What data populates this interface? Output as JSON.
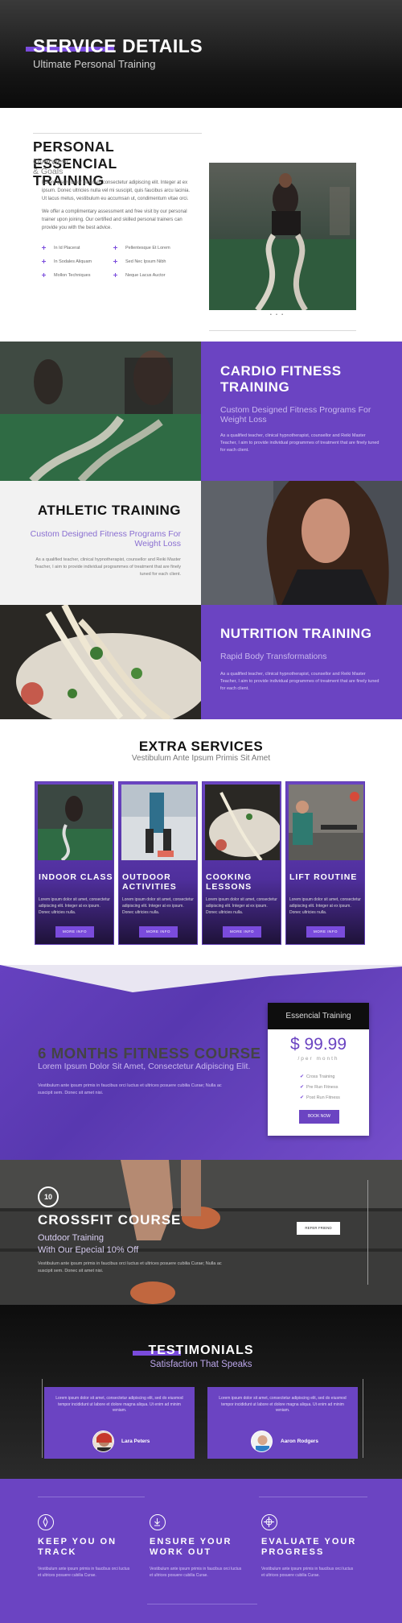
{
  "hero": {
    "title": "SERVICE DETAILS",
    "subtitle": "Ultimate Personal Training"
  },
  "personal": {
    "title": "PERSONAL ESSENCIAL TRAINING",
    "subtitle": "Overview & Goals",
    "p1": "Lorem ipsum dolor sit amet, consectetur adipiscing elit. Integer at ex ipsum. Donec ultricies nulla vel mi suscipit, quis faucibus arcu lacinia. Ut lacus metus, vestibulum eu accumsan ut, condimentum vitae orci.",
    "p2": "We offer a complimentary assessment and free visit by our personal trainer upon joining. Our certified and skilled personal trainers can provide you with the best advice.",
    "features": [
      "In Id Placerat",
      "In Sodales Aliquam",
      "Mollon Techniques",
      "Pellentesque Et Lorem",
      "Sed Nec Ipsum Nibh",
      "Neque Lacus Auctor"
    ],
    "dots": "• • •"
  },
  "cardio": {
    "title": "CARDIO FITNESS TRAINING",
    "subtitle": "Custom Designed Fitness Programs For Weight Loss",
    "text": "As a qualified teacher, clinical hypnotherapist, counsellor and Reiki Master Teacher, I aim to provide individual programmes of treatment that are finely tuned for each client."
  },
  "athletic": {
    "title": "ATHLETIC TRAINING",
    "subtitle": "Custom Designed Fitness Programs For Weight Loss",
    "text": "As a qualified teacher, clinical hypnotherapist, counsellor and Reiki Master Teacher, I aim to provide individual programmes of treatment that are finely tuned for each client."
  },
  "nutrition": {
    "title": "NUTRITION TRAINING",
    "subtitle": "Rapid Body Transformations",
    "text": "As a qualified teacher, clinical hypnotherapist, counsellor and Reiki Master Teacher, I aim to provide individual programmes of treatment that are finely tuned for each client."
  },
  "extra": {
    "title": "EXTRA SERVICES",
    "subtitle": "Vestibulum Ante Ipsum Primis Sit Amet",
    "cards": [
      {
        "title": "INDOOR CLASS",
        "text": "Lorem ipsum dolor sit amet, consectetur adipiscing elit. Integer at ex ipsum. Donec ultricies nulla.",
        "button": "MORE INFO"
      },
      {
        "title": "OUTDOOR ACTIVITIES",
        "text": "Lorem ipsum dolor sit amet, consectetur adipiscing elit. Integer at ex ipsum. Donec ultricies nulla.",
        "button": "MORE INFO"
      },
      {
        "title": "COOKING LESSONS",
        "text": "Lorem ipsum dolor sit amet, consectetur adipiscing elit. Integer at ex ipsum. Donec ultricies nulla.",
        "button": "MORE INFO"
      },
      {
        "title": "LIFT ROUTINE",
        "text": "Lorem ipsum dolor sit amet, consectetur adipiscing elit. Integer at ex ipsum. Donec ultricies nulla.",
        "button": "MORE INFO"
      }
    ]
  },
  "course": {
    "title": "6 MONTHS FITNESS COURSE",
    "subtitle": "Lorem Ipsum Dolor Sit Amet, Consectetur Adipiscing Elit.",
    "text": "Vestibulum ante ipsum primis in faucibus orci luctus et ultrices posuere cubilia Curae; Nulla ac suscipit sem. Donec sit amet nisi.",
    "price": {
      "header": "Essencial Training",
      "amount": "$ 99.99",
      "period": "/per month",
      "items": [
        "Cross Training",
        "Pre Run Fitness",
        "Post Run Fitness"
      ],
      "button": "BOOK NOW"
    }
  },
  "crossfit": {
    "badge": "10",
    "title": "CROSSFIT COURSE",
    "subtitle1": "Outdoor Training",
    "subtitle2": "With Our Epecial 10% Off",
    "text": "Vestibulum ante ipsum primis in faucibus orci luctus et ultrices posuere cubilia Curae; Nulla ac suscipit sem. Donec sit amet nisi.",
    "button": "REFER FRIEND"
  },
  "testimonials": {
    "title": "TESTIMONIALS",
    "subtitle": "Satisfaction That Speaks",
    "items": [
      {
        "text": "Lorem ipsum dolor sit amet, consectetur adipiscing elit, sed do eiusmod tempor incididunt ut labore et dolore magna aliqua. Ut enim ad minim veniam.",
        "name": "Lara Peters"
      },
      {
        "text": "Lorem ipsum dolor sit amet, consectetur adipiscing elit, sed do eiusmod tempor incididunt ut labore et dolore magna aliqua. Ut enim ad minim veniam.",
        "name": "Aaron Rodgers"
      }
    ]
  },
  "goals": [
    {
      "icon": "compass-icon",
      "title": "KEEP YOU ON TRACK",
      "text": "Vestibulum ante ipsum primis in faucibus orci luctus et ultrices posuere cubilia Curae."
    },
    {
      "icon": "download-icon",
      "title": "ENSURE YOUR WORK OUT",
      "text": "Vestibulum ante ipsum primis in faucibus orci luctus et ultrices posuere cubilia Curae."
    },
    {
      "icon": "crosshair-icon",
      "title": "EVALUATE YOUR PROGRESS",
      "text": "Vestibulum ante ipsum primis in faucibus orci luctus et ultrices posuere cubilia Curae."
    }
  ]
}
